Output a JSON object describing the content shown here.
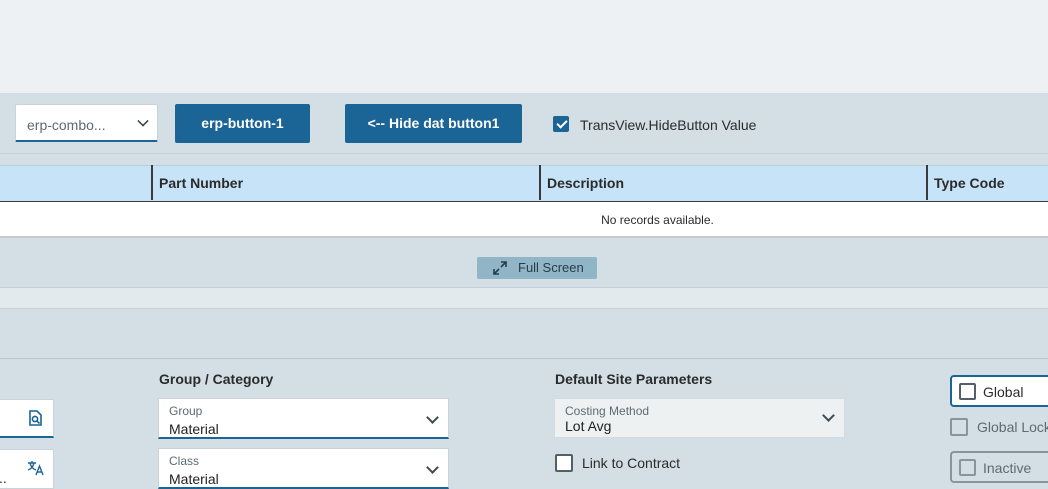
{
  "toolbar": {
    "combo_value": "erp-combo...",
    "button1_label": "erp-button-1",
    "button2_label": "<-- Hide dat button1",
    "checkbox_label": "TransView.HideButton Value",
    "checkbox_checked": true
  },
  "grid": {
    "columns": [
      "Part Number",
      "Description",
      "Type Code"
    ],
    "empty_message": "No records available.",
    "full_screen_label": "Full Screen"
  },
  "form": {
    "left_field_fragment": "..",
    "group_category": {
      "title": "Group / Category",
      "group_label": "Group",
      "group_value": "Material",
      "class_label": "Class",
      "class_value": "Material"
    },
    "default_site": {
      "title": "Default Site Parameters",
      "costing_label": "Costing Method",
      "costing_value": "Lot Avg",
      "link_contract_label": "Link to Contract",
      "link_contract_checked": false
    },
    "flags": {
      "global_label": "Global",
      "global_lock_label": "Global Lock",
      "inactive_label": "Inactive"
    }
  },
  "colors": {
    "accent": "#1a6496",
    "header_bg": "#c6e3f7",
    "panel_bg": "#d3dfe4"
  },
  "icons": [
    "chevron-down-icon",
    "checkmark-icon",
    "expand-icon",
    "search-doc-icon",
    "translate-icon"
  ]
}
